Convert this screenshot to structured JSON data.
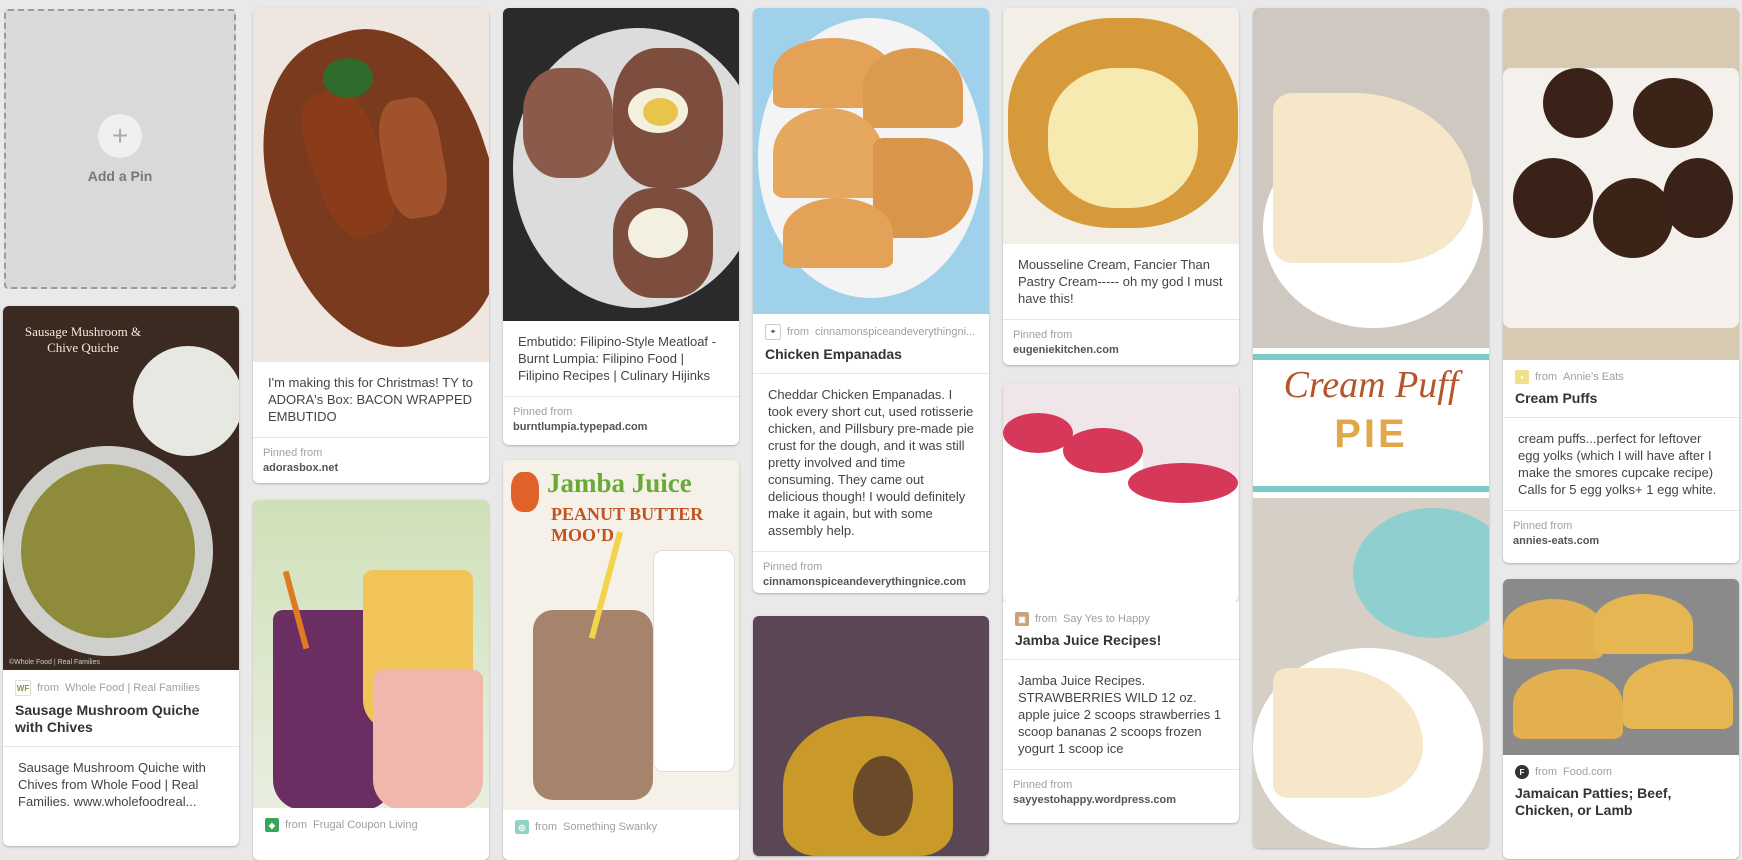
{
  "add_pin": {
    "label": "Add a Pin",
    "icon": "plus-icon"
  },
  "pins": {
    "quiche": {
      "image_caption": "Sausage Mushroom & Chive Quiche",
      "image_credit": "©Whole Food | Real Families",
      "from_prefix": "from",
      "from": "Whole Food | Real Families",
      "title": "Sausage Mushroom Quiche with Chives",
      "description": "Sausage Mushroom Quiche with Chives from Whole Food | Real Families. www.wholefoodreal..."
    },
    "embutido_bacon": {
      "description": "I'm making this for Christmas! TY to ADORA's Box: BACON WRAPPED EMBUTIDO",
      "pinned_label": "Pinned from",
      "source": "adorasbox.net"
    },
    "jamba_frugal": {
      "from_prefix": "from",
      "from": "Frugal Coupon Living"
    },
    "embutido": {
      "description": "Embutido: Filipino-Style Meatloaf - Burnt Lumpia: Filipino Food | Filipino Recipes | Culinary Hijinks",
      "pinned_label": "Pinned from",
      "source": "burntlumpia.typepad.com"
    },
    "jamba_peanut": {
      "image_title": "Jamba Juice",
      "image_subtitle": "PEANUT BUTTER MOO'D",
      "from_prefix": "from",
      "from": "Something Swanky"
    },
    "empanadas": {
      "from_prefix": "from",
      "from": "cinnamonspiceandeverythingni...",
      "title": "Chicken Empanadas",
      "description": "Cheddar Chicken Empanadas. I took every short cut, used rotisserie chicken, and Pillsbury pre-made pie crust for the dough, and it was still pretty involved and time consuming. They came out delicious though! I would definitely make it again, but with some assembly help.",
      "pinned_label": "Pinned from",
      "source": "cinnamonspiceandeverythingnice.com"
    },
    "mousseline": {
      "description": "Mousseline Cream, Fancier Than Pastry Cream----- oh my god I must have this!",
      "pinned_label": "Pinned from",
      "source": "eugeniekitchen.com"
    },
    "jamba_recipes": {
      "from_prefix": "from",
      "from": "Say Yes to Happy",
      "title": "Jamba Juice Recipes!",
      "description": "Jamba Juice Recipes. STRAWBERRIES WILD 12 oz. apple juice 2 scoops strawberries 1 scoop bananas 2 scoops frozen yogurt 1 scoop ice",
      "pinned_label": "Pinned from",
      "source": "sayyestohappy.wordpress.com"
    },
    "cream_puff_pie": {
      "image_line1": "Cream Puff",
      "image_line2": "PIE"
    },
    "cream_puffs": {
      "from_prefix": "from",
      "from": "Annie's Eats",
      "title": "Cream Puffs",
      "description": "cream puffs...perfect for leftover egg yolks (which I will have after I make the smores cupcake recipe) Calls for 5 egg yolks+ 1 egg white.",
      "pinned_label": "Pinned from",
      "source": "annies-eats.com"
    },
    "jamaican_patties": {
      "from_prefix": "from",
      "from": "Food.com",
      "title": "Jamaican Patties; Beef, Chicken, or Lamb"
    }
  },
  "colors": {
    "background": "#e9e9e9",
    "card": "#ffffff",
    "jamba_red": "#d62b3f",
    "cream_puff_brown": "#b5562a",
    "pie_gold": "#e0a84a"
  }
}
